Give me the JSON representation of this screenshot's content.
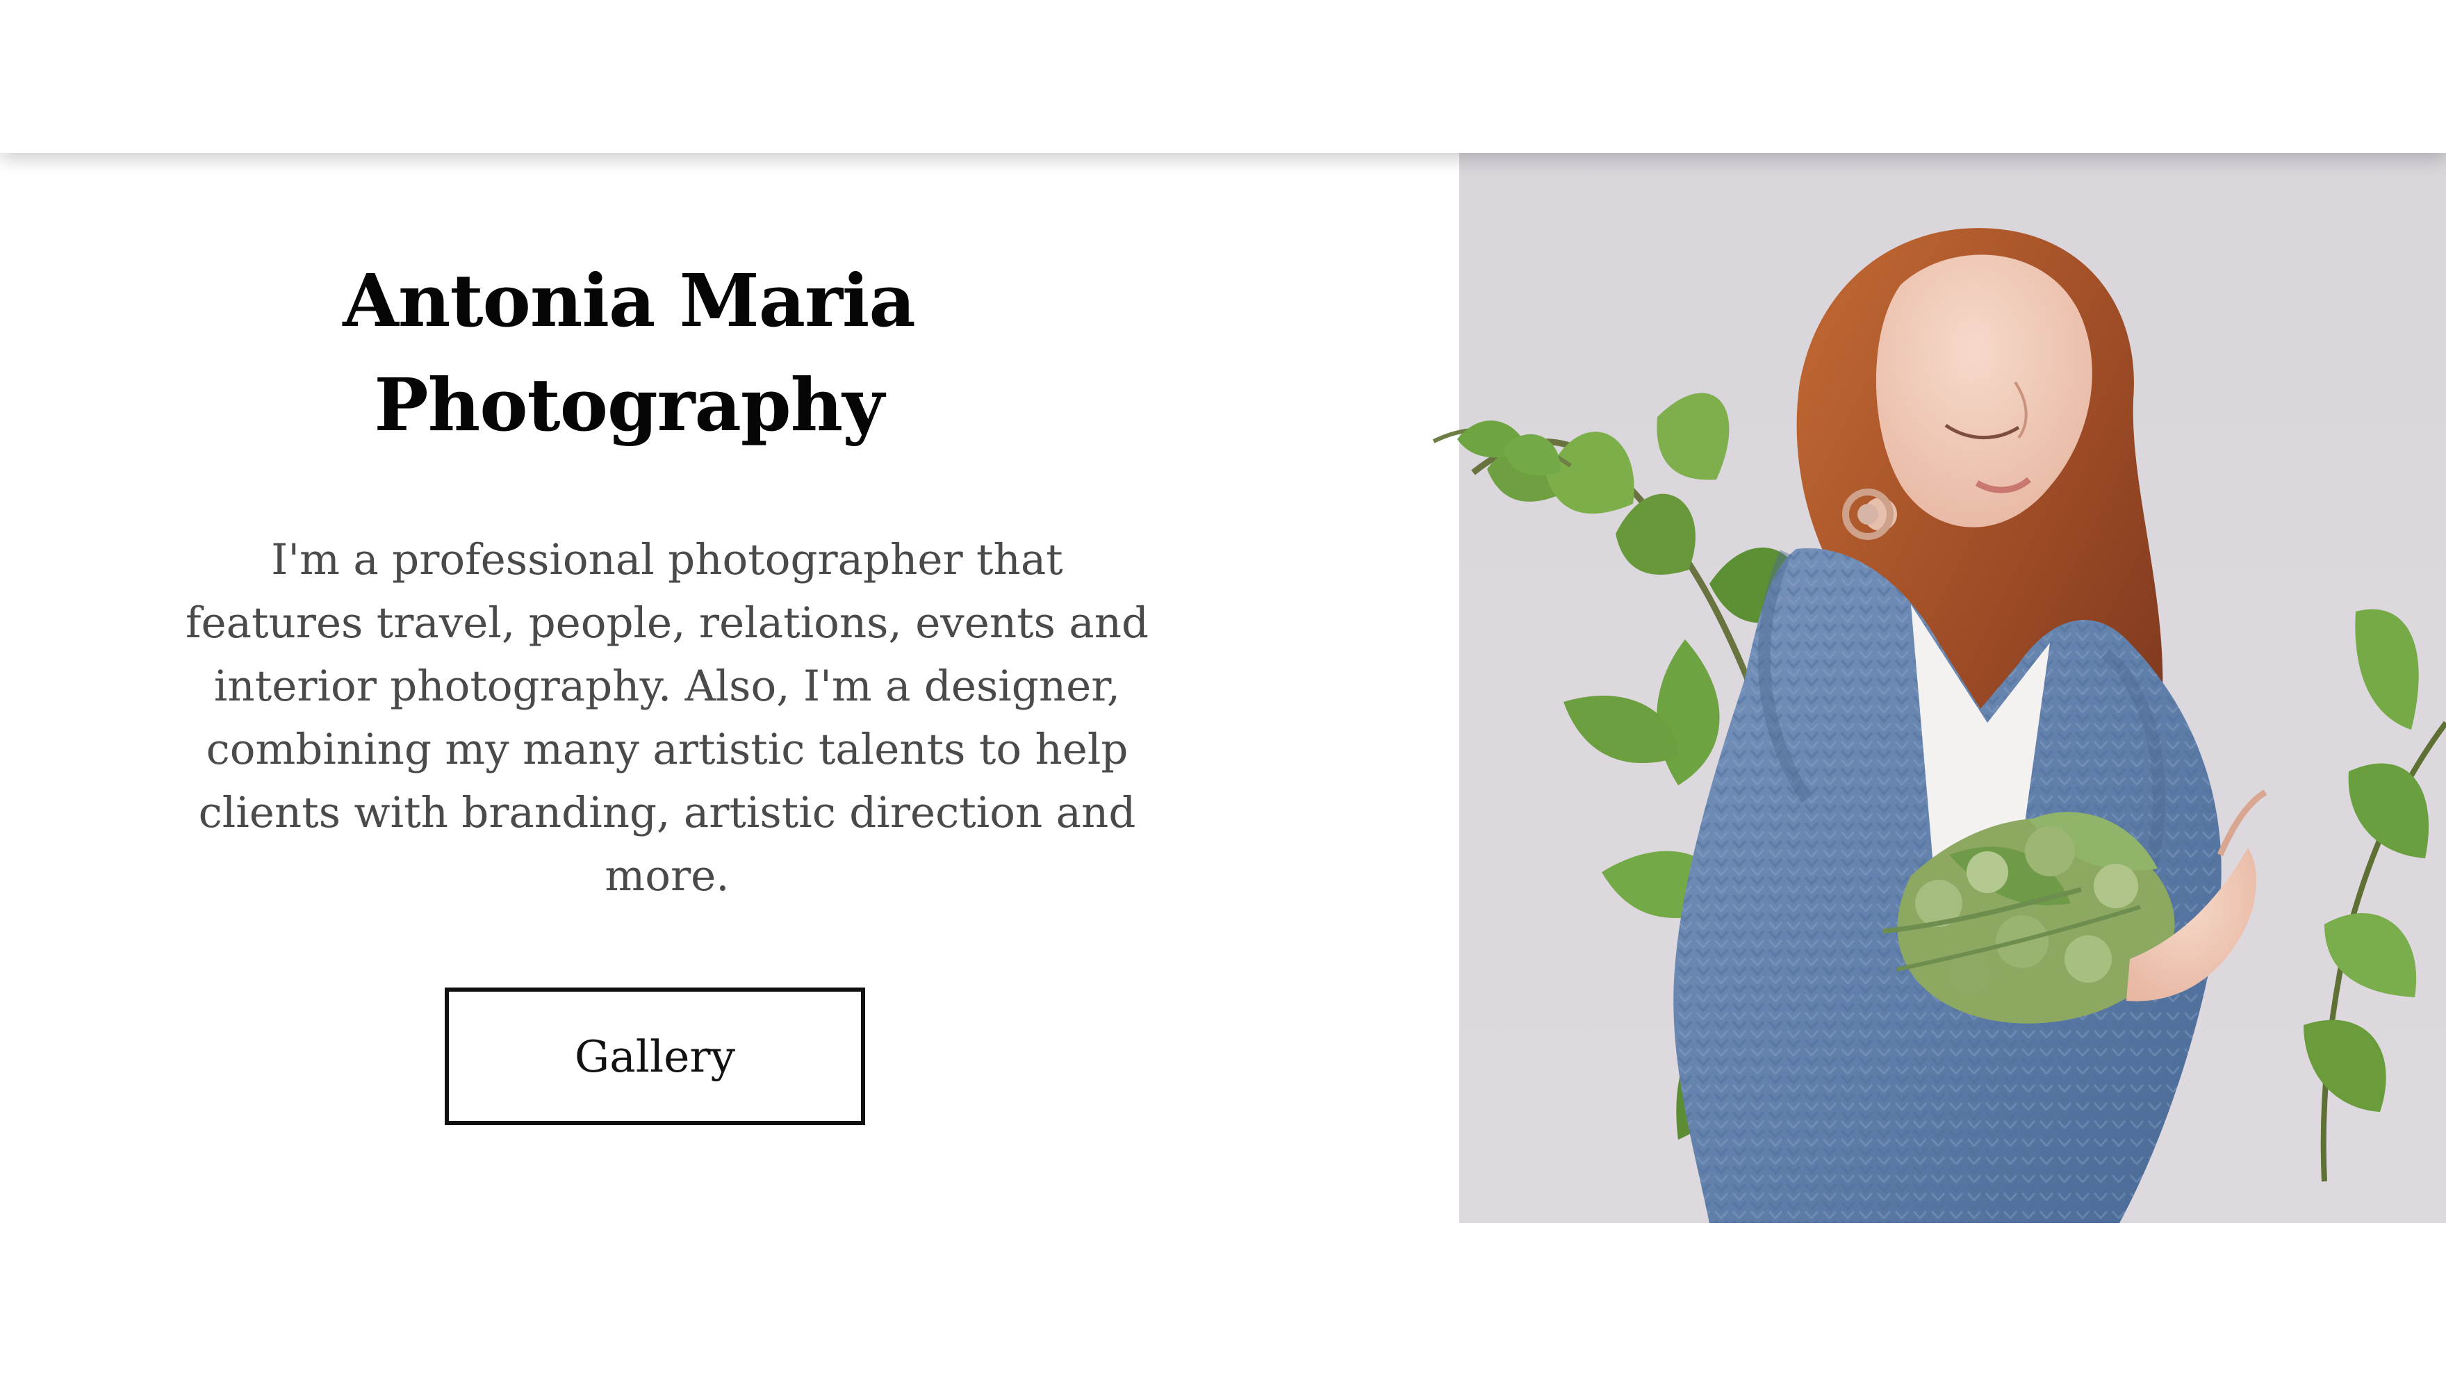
{
  "hero": {
    "title_line_1": "Antonia Maria",
    "title_line_2": "Photography",
    "description_lines": [
      "I'm a professional photographer that",
      "features travel, people, relations, events and",
      "interior photography. Also, I'm a designer,",
      "combining my many artistic talents to help",
      "clients with branding, artistic direction and",
      "more."
    ],
    "button_label": "Gallery"
  },
  "colors": {
    "background": "#ffffff",
    "title": "#050505",
    "body_text": "#4a4a4a",
    "photo_background": "#dcd8dd",
    "sweater": "#5f7ea9",
    "hair": "#b05a2c",
    "leaves": "#6fa043"
  },
  "icons": {
    "photo": "portrait-photo"
  }
}
